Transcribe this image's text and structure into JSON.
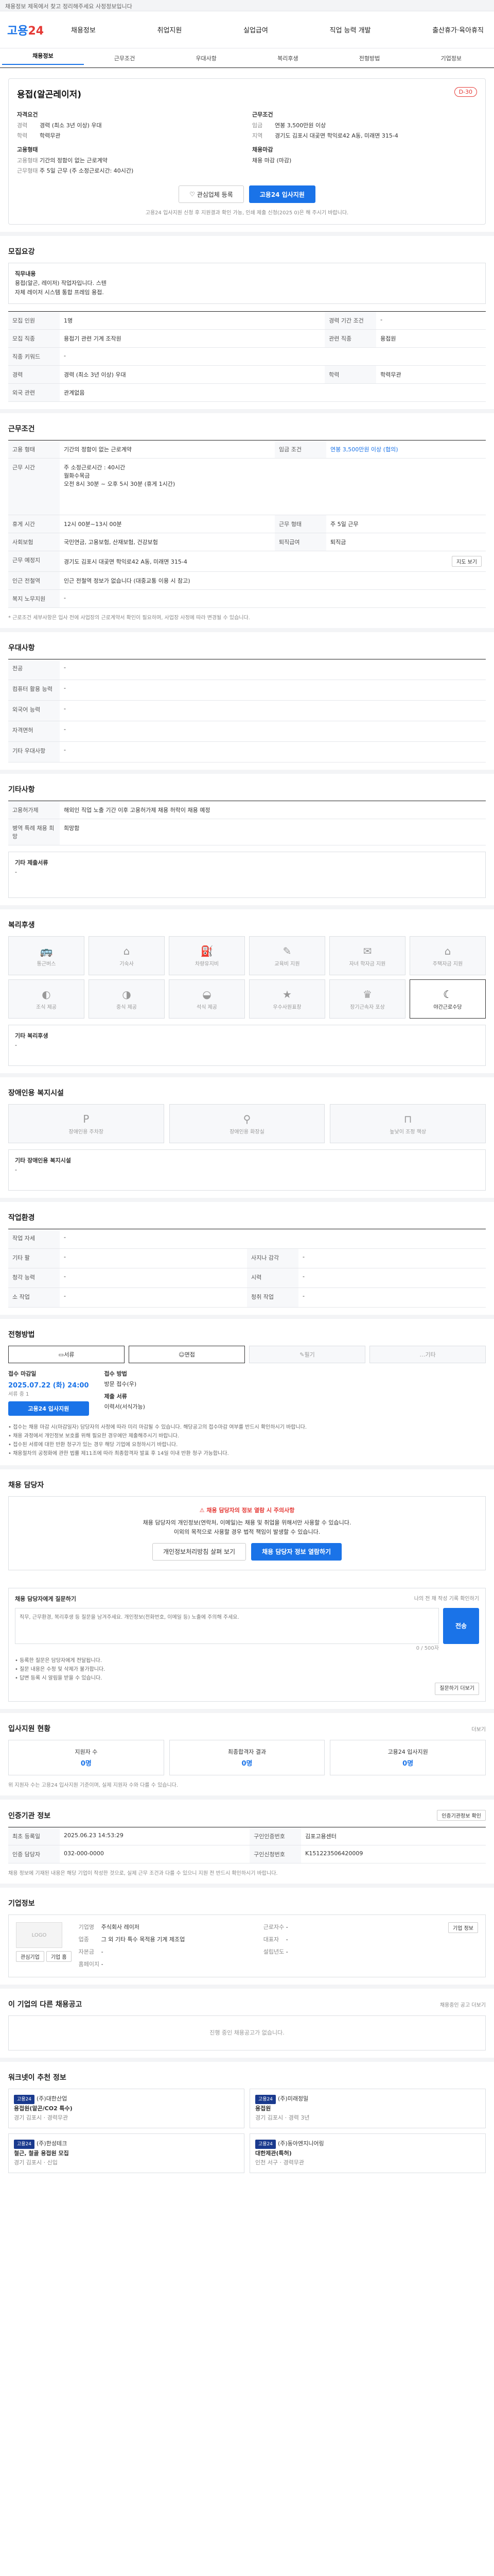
{
  "topbar": {
    "notice": "채용정보 제목에서 찾고 정리해주세요 사정정보입니다"
  },
  "header": {
    "logo_main": "고용",
    "logo_num": "24",
    "menu": [
      "채용정보",
      "취업지원",
      "실업급여",
      "직업 능력 개발",
      "출산휴가·육아휴직"
    ]
  },
  "subnav": [
    "채용정보",
    "근무조건",
    "우대사항",
    "복리후생",
    "전형방법",
    "기업정보"
  ],
  "summary": {
    "title": "용접(알곤레이저)",
    "dday": "D-30",
    "left_head": "자격요건",
    "left": [
      {
        "k": "경력",
        "v": "경력 (최소 3년 이상) 우대"
      },
      {
        "k": "학력",
        "v": "학력무관"
      }
    ],
    "right_head": "근무조건",
    "right": [
      {
        "k": "임금",
        "v": "연봉 3,500만원 이상"
      },
      {
        "k": "지역",
        "v": "경기도 김포시 대곶면 학익로42 A동, 미래면 315-4"
      }
    ],
    "left2_head": "고용형태",
    "left2": [
      {
        "k": "고용형태",
        "v": "기간의 정함이 없는 근로계약"
      },
      {
        "k": "근무형태",
        "v": "주 5일 근무 (주 소정근로시간: 40시간)"
      }
    ],
    "right2_head": "채용마감",
    "right2": [
      {
        "k": "",
        "v": "채용 마감 (마감)"
      }
    ],
    "btn_scrap": "관심업체 등록",
    "btn_apply": "고용24 입사지원",
    "notice": "고용24 입사지원 신청 후 지원결과 확인 가능, 인쇄 제출 신청(2025 0)은 해 주시기 바랍니다."
  },
  "recruit": {
    "head": "모집요강",
    "job_label": "직무내용",
    "job_text": "용접(알곤, 레이저) 작업자입니다. 스텐\n자체 레이저 시스템 통합 프레임 용접.",
    "rows": [
      {
        "k1": "모집 인원",
        "v1": "1명",
        "k2": "경력 기간 조건",
        "v2": "-"
      },
      {
        "k1": "모집 직종",
        "v1": "용접기 관련 기계 조작원",
        "k2": "관련 직종",
        "v2": "용접원"
      },
      {
        "k1": "직종 키워드",
        "v1": "-",
        "k2": "",
        "v2": ""
      },
      {
        "k1": "경력",
        "v1": "경력 (최소 3년 이상) 우대",
        "k2": "학력",
        "v2": "학력무관"
      },
      {
        "k1": "외국 관련",
        "v1": "관계없음",
        "k2": "",
        "v2": ""
      }
    ]
  },
  "conditions": {
    "head": "근무조건",
    "rows": [
      {
        "k": "고용 형태",
        "v": "기간의 정함이 없는 근로계약",
        "k2": "임금 조건",
        "v2": "연봉 3,500만원 이상 (협의)"
      },
      {
        "k": "근무 시간",
        "v": "주 소정근로시간 : 40시간\n월화수목금\n오전 8시 30분 ~ 오후 5시 30분 (휴게 1시간)"
      },
      {
        "k": "휴게 시간",
        "v": "12시 00분~13시 00분",
        "k2": "근무 형태",
        "v2": "주 5일 근무"
      },
      {
        "k": "사회보험",
        "v": "국민연금, 고용보험, 산재보험, 건강보험",
        "k2": "퇴직급여",
        "v2": "퇴직금"
      },
      {
        "k": "근무 예정지",
        "v": "경기도 김포시 대곶면 학익로42 A동, 미래면 315-4",
        "btn": "지도 보기"
      },
      {
        "k": "인근 전철역",
        "v": "인근 전철역 정보가 없습니다 (대중교통 이용 시 참고)"
      },
      {
        "k": "복지 노무지원",
        "v": "-"
      }
    ],
    "foot": "* 근로조건 세부사항은 입사 전에 사업장의 근로계약서 확인이 필요하며, 사업장 사정에 따라 변경될 수 있습니다."
  },
  "preference": {
    "head": "우대사항",
    "rows": [
      {
        "k": "전공",
        "v": "-"
      },
      {
        "k": "컴퓨터 활용 능력",
        "v": "-"
      },
      {
        "k": "외국어 능력",
        "v": "-"
      },
      {
        "k": "자격면허",
        "v": "-"
      },
      {
        "k": "기타 우대사항",
        "v": "-"
      }
    ]
  },
  "etc": {
    "head": "기타사항",
    "rows": [
      {
        "k": "고용허가제",
        "v": "해외인 직업 노출 기간 이후 고용허가제 채용 허락이 채용 예정"
      },
      {
        "k": "병역 특례 채용 희망",
        "v": "희망함"
      }
    ],
    "sub_head": "기타 제출서류",
    "sub_val": "-"
  },
  "welfare": {
    "head": "복리후생",
    "items": [
      "통근버스",
      "기숙사",
      "차량유지비",
      "교육비 지원",
      "자녀 학자금 지원",
      "주택자금 지원",
      "조식 제공",
      "중식 제공",
      "석식 제공",
      "우수사원표창",
      "장기근속자 포상",
      "야간근로수당"
    ],
    "on_index": 11,
    "extra_head": "기타 복리후생",
    "extra_val": "-"
  },
  "disability": {
    "head": "장애인용 복지시설",
    "items": [
      "장애인용 주차장",
      "장애인용 화장실",
      "높낮이 조정 책상"
    ],
    "extra_head": "기타 장애인용 복지시설",
    "extra_val": "-"
  },
  "worktype": {
    "head": "작업환경",
    "rows": [
      {
        "k": "작업 자세",
        "v": "-",
        "k2": "",
        "v2": ""
      },
      {
        "k": "기타 팔",
        "v": "-",
        "k2": "사지나 감각",
        "v2": "-"
      },
      {
        "k": "청각 능력",
        "v": "-",
        "k2": "시력",
        "v2": "-"
      },
      {
        "k": "소 작업",
        "v": "-",
        "k2": "청취 작업",
        "v2": "-"
      }
    ]
  },
  "apply": {
    "head": "전형방법",
    "methods": [
      "서류",
      "면접",
      "필기",
      "기타"
    ],
    "methods_on": [
      0,
      1
    ],
    "deadline_head": "접수 마감일",
    "deadline": "2025.07.22 (화) 24:00",
    "deadline_sub": "서류 중 1",
    "method_head": "접수 방법",
    "method_val": "방문 접수(우)",
    "docs_head": "제출 서류",
    "docs_val": "이력서(서식가능)",
    "apply_btn": "고용24 입사지원",
    "bullets": [
      "접수는 채용 마감 시(마감일자) 담당자의 사정에 따라 미리 마감될 수 있습니다. 해당공고의 접수마감 여부를 반드시 확인하시기 바랍니다.",
      "채용 과정에서 개인정보 보호를 위해 필요한 경우에만 제출해주시기 바랍니다.",
      "접수된 서류에 대한 반환 청구가 있는 경우 해당 기업에 요청하시기 바랍니다.",
      "채용절차의 공정화에 관한 법률 제11조에 따라 최종합격자 발표 후 14일 이내 반환 청구 가능합니다."
    ]
  },
  "contact": {
    "head": "채용 담당자",
    "alert_title": "채용 담당자의 정보 열람 시 주의사항",
    "alert_text": "채용 담당자의 개인정보(연락처, 이메일)는 채용 및 취업을 위해서만 사용할 수 있습니다.\n이외의 목적으로 사용할 경우 법적 책임이 발생할 수 있습니다.",
    "btn_privacy": "개인정보처리방침 살펴 보기",
    "btn_view": "채용 담당자 정보 열람하기"
  },
  "inquiry": {
    "head": "채용 담당자에게 질문하기",
    "right": "나의 전 채 작성 기록 확인하기",
    "placeholder": "직무, 근무환경, 복리후생 등 질문을 남겨주세요. 개인정보(전화번호, 이메일 등) 노출에 주의해 주세요.",
    "counter": "0 / 500자",
    "btn": "전송",
    "bullets": [
      "등록한 질문은 담당자에게 전달됩니다.",
      "질문 내용은 수정 및 삭제가 불가합니다.",
      "답변 등록 시 알림을 받을 수 있습니다."
    ],
    "more_btn": "질문하기 더보기"
  },
  "applicants": {
    "head": "입사지원 현황",
    "right": "더보기",
    "items": [
      {
        "label": "지원자 수",
        "val": "0명"
      },
      {
        "label": "최종합격자 결과",
        "val": "0명"
      },
      {
        "label": "고용24 입사지원",
        "val": "0명"
      }
    ],
    "foot": "위 지원자 수는 고용24 입사지원 기준이며, 실제 지원자 수와 다를 수 있습니다."
  },
  "info": {
    "head": "인증기관 정보",
    "right": "인증기관정보 확인",
    "rows": [
      {
        "k": "최초 등록일",
        "v": "2025.06.23 14:53:29",
        "k2": "구인인증번호",
        "v2": "김포고용센터"
      },
      {
        "k": "인증 담당자",
        "v": "032-000-0000",
        "k2": "구인신청번호",
        "v2": "K151223506420009"
      }
    ],
    "note": "채용 정보에 기재된 내용은 해당 기업이 작성한 것으로, 실제 근무 조건과 다를 수 있으니 지원 전 반드시 확인하시기 바랍니다."
  },
  "companyinfo": {
    "head": "기업정보",
    "logo": "LOGO",
    "btn1": "관심기업",
    "btn2": "기업 홈",
    "fields": [
      {
        "k": "기업명",
        "v": "주식회사 레이저"
      },
      {
        "k": "업종",
        "v": "그 외 기타 특수 목적용 기계 제조업"
      },
      {
        "k": "근로자수",
        "v": "-"
      },
      {
        "k": "대표자",
        "v": "-"
      },
      {
        "k": "자본금",
        "v": "-"
      },
      {
        "k": "설립년도",
        "v": "-"
      },
      {
        "k": "홈페이지",
        "v": "-"
      }
    ],
    "side_btn": "기업 정보"
  },
  "other": {
    "head": "이 기업의 다른 채용공고",
    "right": "채용중인 공고 더보기",
    "empty": "진행 중인 채용공고가 없습니다."
  },
  "ai": {
    "head": "워크넷이 추천 정보",
    "items": [
      {
        "tag": "고용24",
        "company": "(주)대한산업",
        "title": "용접원(알곤/CO2 특수)",
        "sub": "경기 김포시 · 경력무관"
      },
      {
        "tag": "고용24",
        "company": "(주)미래정밀",
        "title": "용접원",
        "sub": "경기 김포시 · 경력 3년"
      },
      {
        "tag": "고용24",
        "company": "(주)한성테크",
        "title": "철근, 철골 용접원 모집",
        "sub": "경기 김포시 · 신입"
      },
      {
        "tag": "고용24",
        "company": "(주)동아엔지니어링",
        "title": "대한제관(특허)",
        "sub": "인천 서구 · 경력무관"
      }
    ]
  },
  "colors": {
    "accent": "#1a73e8",
    "danger": "#e53935",
    "navy": "#1a3a8e"
  }
}
